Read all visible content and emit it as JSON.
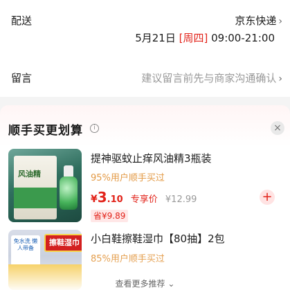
{
  "delivery": {
    "label": "配送",
    "carrier": "京东快递",
    "date": "5月21日",
    "weekday": "[周四]",
    "time": "09:00-21:00"
  },
  "note": {
    "label": "留言",
    "placeholder": "建议留言前先与商家沟通确认"
  },
  "addon_section": {
    "title": "顺手买更划算",
    "info_icon": "i",
    "close_icon": "×",
    "see_more": "查看更多推荐",
    "products": [
      {
        "name": "提神驱蚊止痒风油精3瓶装",
        "subtitle": "95%用户顺手买过",
        "currency": "¥",
        "price_int": "3",
        "price_dec": ".10",
        "price_tag": "专享价",
        "old_price": "¥12.99",
        "save": "省¥9.89",
        "image_text": "风油精"
      },
      {
        "name": "小白鞋擦鞋湿巾【80抽】2包",
        "subtitle": "85%用户顺手买过",
        "image_banner": "擦鞋湿巾",
        "image_text": "免水洗 懒人带备"
      }
    ]
  },
  "colors": {
    "accent": "#e2231a",
    "subtitle": "#e39a45"
  }
}
